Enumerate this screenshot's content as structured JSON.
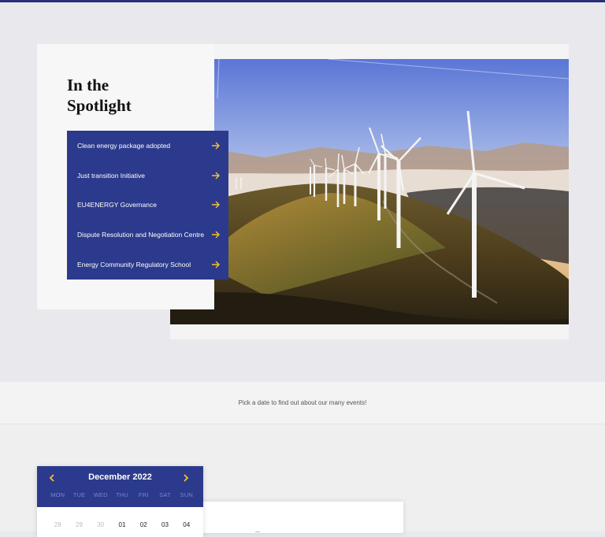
{
  "spotlight": {
    "title_line1": "In the",
    "title_line2": "Spotlight",
    "items": [
      {
        "label": "Clean energy package adopted"
      },
      {
        "label": "Just transition Initiative"
      },
      {
        "label": "EU4ENERGY Governance"
      },
      {
        "label": "Dispute Resolution and Negotiation Centre"
      },
      {
        "label": "Energy Community Regulatory School"
      }
    ]
  },
  "events": {
    "prompt": "Pick a date to find out about our many events!"
  },
  "calendar": {
    "month": "December 2022",
    "weekdays": [
      "MON",
      "TUE",
      "WED",
      "THU",
      "FRI",
      "SAT",
      "SUN"
    ],
    "days": [
      {
        "label": "28",
        "muted": true
      },
      {
        "label": "29",
        "muted": true
      },
      {
        "label": "30",
        "muted": true
      },
      {
        "label": "01",
        "muted": false
      },
      {
        "label": "02",
        "muted": false
      },
      {
        "label": "03",
        "muted": false
      },
      {
        "label": "04",
        "muted": false
      }
    ]
  },
  "colors": {
    "brand_navy": "#2b3a8c",
    "accent_yellow": "#f2c230",
    "weekday_text": "#7a86c8"
  },
  "icons": {
    "menu_arrow": "arrow-right-icon",
    "cal_prev": "chevron-left-icon",
    "cal_next": "chevron-right-icon"
  }
}
